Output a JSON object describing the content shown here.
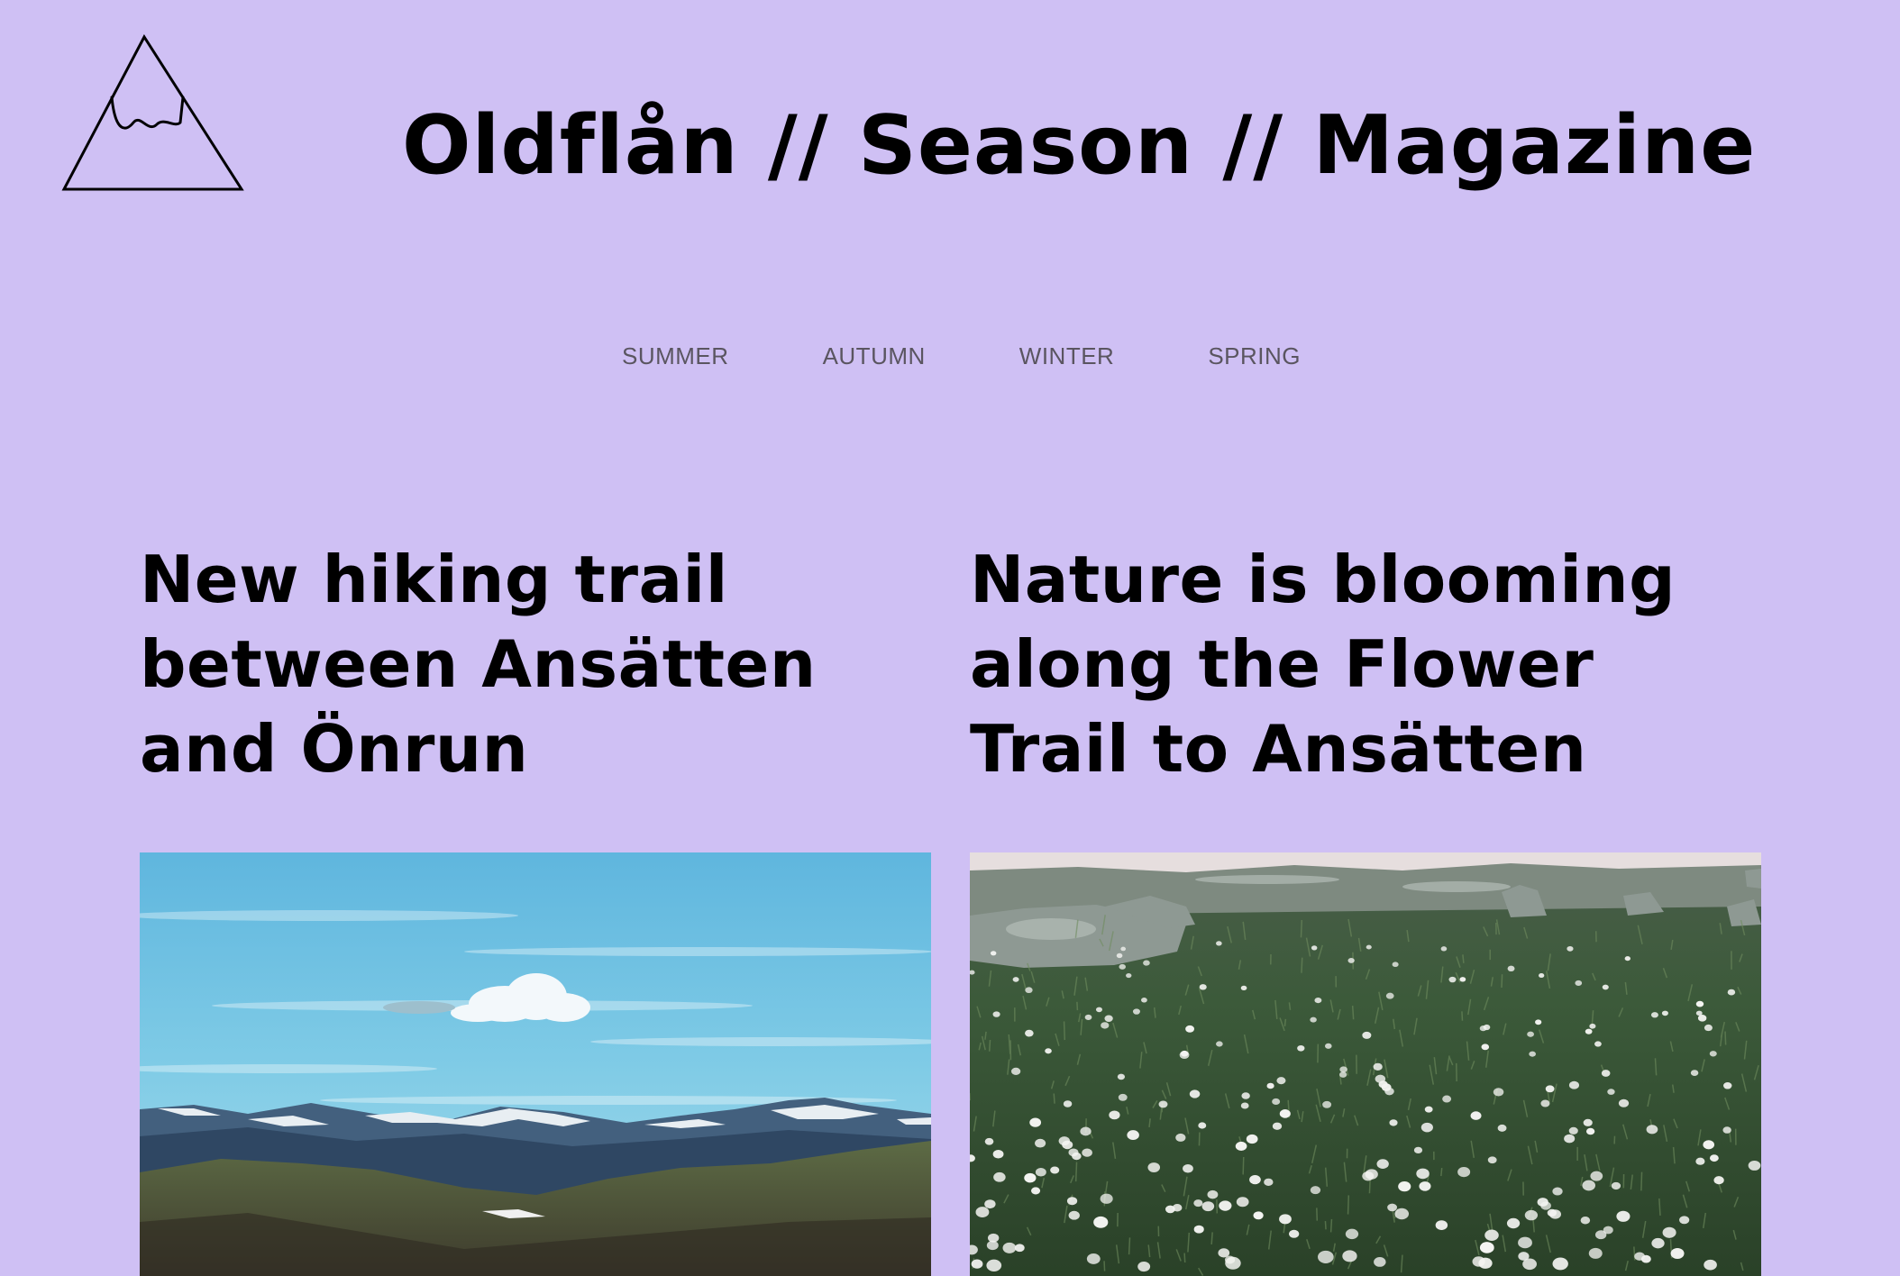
{
  "header": {
    "logo_icon": "mountain-icon",
    "title": "Oldflån // Season // Magazine"
  },
  "nav": {
    "items": [
      {
        "label": "SUMMER"
      },
      {
        "label": "AUTUMN"
      },
      {
        "label": "WINTER"
      },
      {
        "label": "SPRING"
      }
    ]
  },
  "articles": [
    {
      "title": "New hiking trail between Ansätten and Önrun",
      "image": "mountain-landscape-photo"
    },
    {
      "title": "Nature is blooming along the Flower Trail to Ansätten",
      "image": "cotton-grass-meadow-photo"
    }
  ],
  "colors": {
    "background": "#cfc0f4",
    "text": "#000000",
    "nav_text": "#5a5560"
  }
}
